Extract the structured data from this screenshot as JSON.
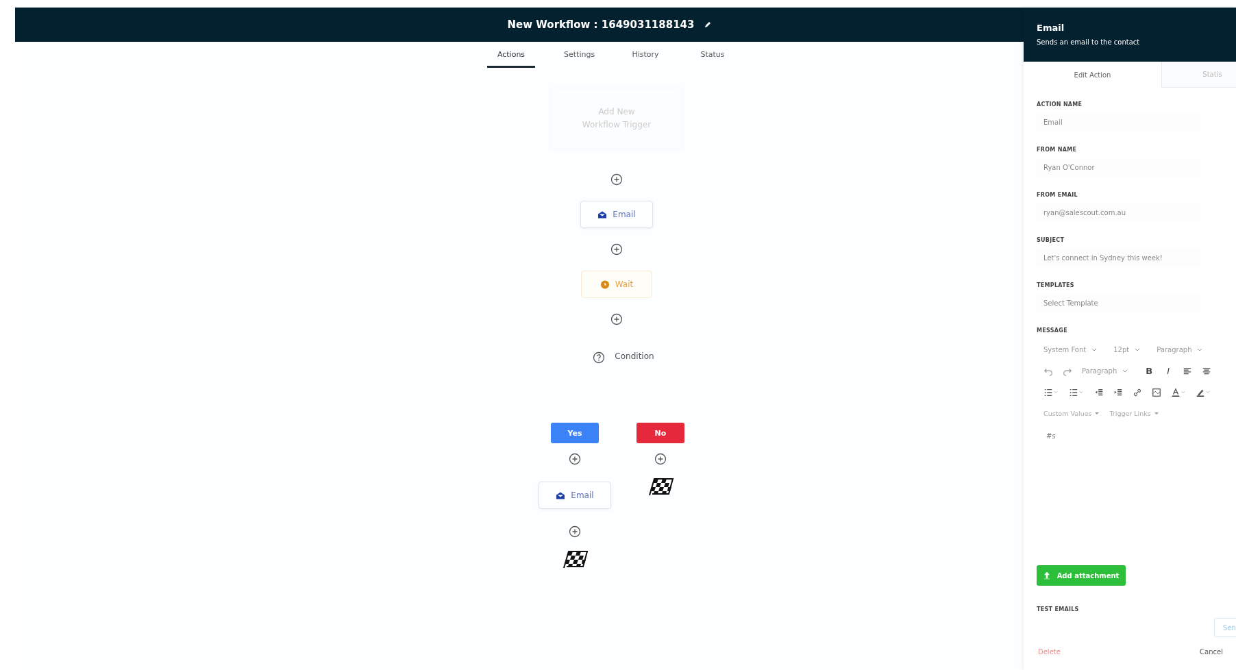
{
  "header": {
    "title": "New Workflow : 1649031188143"
  },
  "tabs": [
    {
      "label": "Actions",
      "selected": true
    },
    {
      "label": "Settings",
      "selected": false
    },
    {
      "label": "History",
      "selected": false
    },
    {
      "label": "Status",
      "selected": false
    }
  ],
  "flow": {
    "trigger": "Add New Workflow Trigger",
    "steps": [
      {
        "kind": "add"
      },
      {
        "kind": "email",
        "label": "Email"
      },
      {
        "kind": "add"
      },
      {
        "kind": "wait",
        "label": "Wait"
      },
      {
        "kind": "add"
      },
      {
        "kind": "condition",
        "label": "Condition"
      }
    ],
    "branches": [
      {
        "label": "Yes",
        "color": "#3b82f6",
        "steps": [
          {
            "kind": "add"
          },
          {
            "kind": "email",
            "label": "Email"
          },
          {
            "kind": "add"
          },
          {
            "kind": "finish"
          }
        ]
      },
      {
        "label": "No",
        "color": "#e5283c",
        "steps": [
          {
            "kind": "add"
          },
          {
            "kind": "finish"
          }
        ]
      }
    ]
  },
  "panel": {
    "title": "Email",
    "subtitle": "Sends an email to the contact",
    "tabs": [
      {
        "label": "Edit Action",
        "selected": true
      },
      {
        "label": "Statis",
        "selected": false
      }
    ],
    "fields": [
      {
        "label": "ACTION NAME",
        "value": "Email"
      },
      {
        "label": "FROM NAME",
        "value": "Ryan O'Connor"
      },
      {
        "label": "FROM EMAIL",
        "value": "ryan@salescout.com.au"
      },
      {
        "label": "SUBJECT",
        "value": "Let's connect in Sydney this week!"
      },
      {
        "label": "TEMPLATES",
        "value": "Select Template"
      }
    ],
    "message": {
      "label": "MESSAGE",
      "toolbar": [
        [
          {
            "kind": "select",
            "text": "System Font"
          },
          {
            "kind": "select",
            "text": "12pt"
          },
          {
            "kind": "select",
            "text": "Paragraph"
          }
        ],
        [
          {
            "kind": "undo"
          },
          {
            "kind": "redo"
          },
          {
            "kind": "select",
            "text": "Paragraph"
          },
          {
            "kind": "glyph",
            "text": "B"
          },
          {
            "kind": "glyph",
            "text": "I"
          },
          {
            "kind": "align-left"
          },
          {
            "kind": "align-center"
          }
        ],
        [
          {
            "kind": "bullets"
          },
          {
            "kind": "numbers"
          },
          {
            "kind": "outdent"
          },
          {
            "kind": "indent"
          },
          {
            "kind": "link"
          },
          {
            "kind": "image"
          },
          {
            "kind": "text-color"
          },
          {
            "kind": "highlight"
          }
        ],
        [
          {
            "kind": "menu",
            "text": "Custom Values"
          },
          {
            "kind": "menu",
            "text": "Trigger Links"
          }
        ]
      ],
      "body": "#s"
    },
    "attachment_button": "Add attachment",
    "test_label": "TEST EMAILS",
    "send_button": "Sen",
    "delete_link": "Delete",
    "cancel_button": "Cancel"
  }
}
